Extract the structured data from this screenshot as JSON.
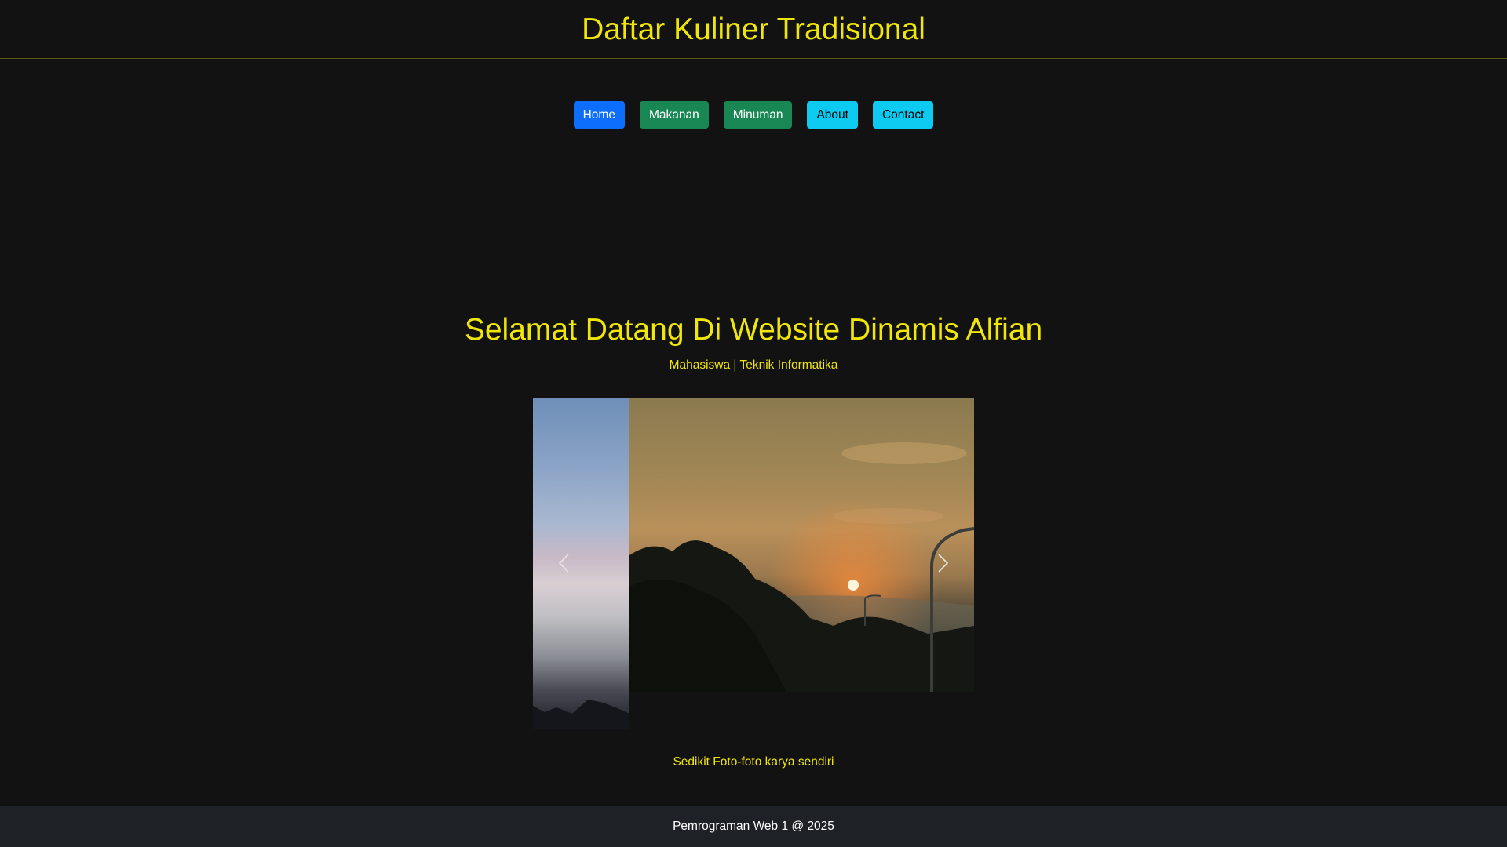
{
  "header": {
    "title": "Daftar Kuliner Tradisional"
  },
  "nav": {
    "items": [
      {
        "label": "Home",
        "style": "primary"
      },
      {
        "label": "Makanan",
        "style": "success"
      },
      {
        "label": "Minuman",
        "style": "success"
      },
      {
        "label": "About",
        "style": "info"
      },
      {
        "label": "Contact",
        "style": "info"
      }
    ]
  },
  "hero": {
    "title": "Selamat Datang Di Website Dinamis Alfian",
    "subtitle": "Mahasiswa | Teknik Informatika"
  },
  "carousel": {
    "prev_icon": "chevron-left-icon",
    "next_icon": "chevron-right-icon",
    "caption": "Sedikit Foto-foto karya sendiri"
  },
  "footer": {
    "text": "Pemrograman Web 1 @ 2025"
  },
  "colors": {
    "background": "#121212",
    "accent_text": "#f0e60a",
    "primary": "#0d6efd",
    "success": "#198754",
    "info": "#0dcaf0",
    "footer_bg": "#1e2227"
  }
}
